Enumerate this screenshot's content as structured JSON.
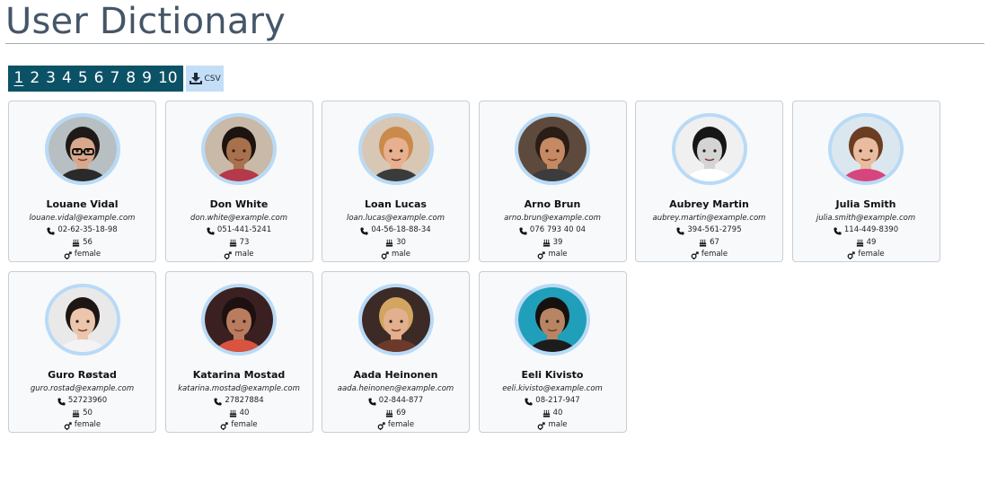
{
  "page_title": "User Dictionary",
  "pagination": {
    "pages": [
      "1",
      "2",
      "3",
      "4",
      "5",
      "6",
      "7",
      "8",
      "9",
      "10"
    ],
    "active": "1"
  },
  "export": {
    "csv_label": "CSV",
    "icon": "download-icon"
  },
  "colors": {
    "title": "#465669",
    "pager_bg": "#0c5266",
    "csv_bg": "#c4def7",
    "avatar_ring": "#b9daf6",
    "card_bg": "#f7f9fb"
  },
  "users": [
    {
      "name": "Louane Vidal",
      "email": "louane.vidal@example.com",
      "phone": "02-62-35-18-98",
      "age": "56",
      "gender": "female"
    },
    {
      "name": "Don White",
      "email": "don.white@example.com",
      "phone": "051-441-5241",
      "age": "73",
      "gender": "male"
    },
    {
      "name": "Loan Lucas",
      "email": "loan.lucas@example.com",
      "phone": "04-56-18-88-34",
      "age": "30",
      "gender": "male"
    },
    {
      "name": "Arno Brun",
      "email": "arno.brun@example.com",
      "phone": "076 793 40 04",
      "age": "39",
      "gender": "male"
    },
    {
      "name": "Aubrey Martin",
      "email": "aubrey.martin@example.com",
      "phone": "394-561-2795",
      "age": "67",
      "gender": "female"
    },
    {
      "name": "Julia Smith",
      "email": "julia.smith@example.com",
      "phone": "114-449-8390",
      "age": "49",
      "gender": "female"
    },
    {
      "name": "Guro Røstad",
      "email": "guro.rostad@example.com",
      "phone": "52723960",
      "age": "50",
      "gender": "female"
    },
    {
      "name": "Katarina Mostad",
      "email": "katarina.mostad@example.com",
      "phone": "27827884",
      "age": "40",
      "gender": "female"
    },
    {
      "name": "Aada Heinonen",
      "email": "aada.heinonen@example.com",
      "phone": "02-844-877",
      "age": "69",
      "gender": "female"
    },
    {
      "name": "Eeli Kivisto",
      "email": "eeli.kivisto@example.com",
      "phone": "08-217-947",
      "age": "40",
      "gender": "male"
    }
  ],
  "icons": {
    "phone": "phone-icon",
    "age": "birthday-cake-icon",
    "gender": "gender-icon"
  }
}
